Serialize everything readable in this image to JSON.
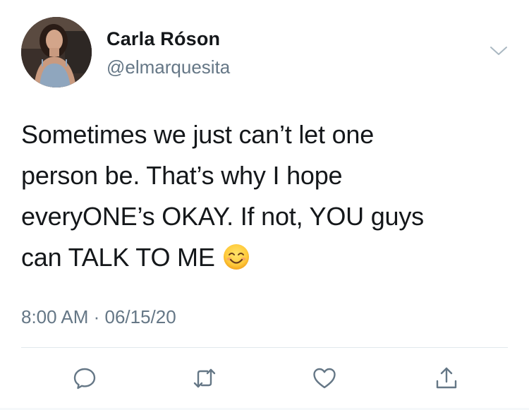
{
  "tweet": {
    "author": {
      "display_name": "Carla Róson",
      "handle": "@elmarquesita",
      "avatar_icon": "profile-photo"
    },
    "text_lines": [
      "Sometimes we just can’t let one",
      "person be. That’s why I hope",
      "everyONE’s OKAY. If not, YOU guys",
      "can TALK TO ME"
    ],
    "emoji": "smiling-face-with-smiling-eyes",
    "timestamp": "8:00 AM · 06/15/20",
    "actions": [
      {
        "name": "reply",
        "icon": "speech-bubble-icon"
      },
      {
        "name": "retweet",
        "icon": "retweet-icon"
      },
      {
        "name": "like",
        "icon": "heart-icon"
      },
      {
        "name": "share",
        "icon": "share-icon"
      }
    ],
    "colors": {
      "text": "#14171a",
      "secondary": "#657786",
      "icon": "#657786",
      "divider": "#e1e8ed"
    }
  }
}
